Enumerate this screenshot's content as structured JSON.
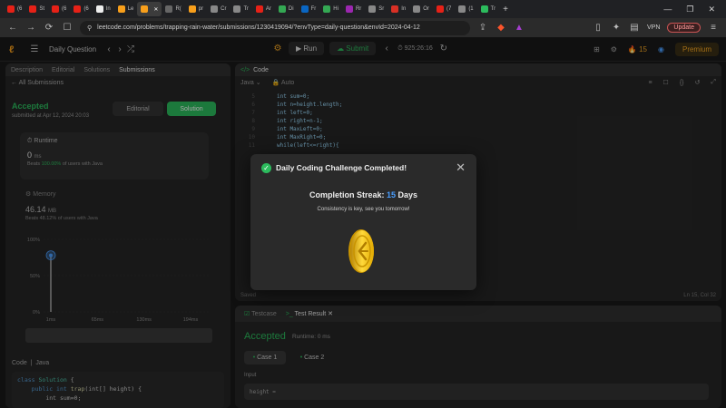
{
  "browser": {
    "tabs": [
      {
        "label": "(6",
        "color": "#e62117"
      },
      {
        "label": "St",
        "color": "#e62117"
      },
      {
        "label": "(6",
        "color": "#e62117"
      },
      {
        "label": "(6",
        "color": "#e62117"
      },
      {
        "label": "In",
        "color": "#eeeeee"
      },
      {
        "label": "Le",
        "color": "#f89f1b"
      },
      {
        "label": "",
        "color": "#f89f1b"
      },
      {
        "label": "R(",
        "color": "#666666"
      },
      {
        "label": "pr",
        "color": "#f89f1b"
      },
      {
        "label": "Cr",
        "color": "#888888"
      },
      {
        "label": "Tr",
        "color": "#888888"
      },
      {
        "label": "Ar",
        "color": "#e62117"
      },
      {
        "label": "Di",
        "color": "#34a853"
      },
      {
        "label": "Fr",
        "color": "#0a66c2"
      },
      {
        "label": "Hi",
        "color": "#34a853"
      },
      {
        "label": "Rr",
        "color": "#9c27b0"
      },
      {
        "label": "Sr",
        "color": "#888888"
      },
      {
        "label": "In",
        "color": "#d93025"
      },
      {
        "label": "Or",
        "color": "#888888"
      },
      {
        "label": "(7",
        "color": "#e62117"
      },
      {
        "label": "(1",
        "color": "#888888"
      },
      {
        "label": "Tr",
        "color": "#2cbb5d"
      }
    ],
    "url": "leetcode.com/problems/trapping-rain-water/submissions/1230419094/?envType=daily-question&envId=2024-04-12",
    "vpn": "VPN",
    "update": "Update"
  },
  "header": {
    "title": "Daily Question",
    "run": "Run",
    "submit": "Submit",
    "timer": "925:26:16",
    "streak": "15",
    "premium": "Premium"
  },
  "left": {
    "tabs": [
      "Description",
      "Editorial",
      "Solutions",
      "Submissions"
    ],
    "all_submissions": "All Submissions",
    "status": "Accepted",
    "submitted": "submitted at Apr 12, 2024 20:03",
    "editorial_btn": "Editorial",
    "solution_btn": "Solution",
    "runtime_label": "Runtime",
    "runtime_value": "0",
    "runtime_unit": "ms",
    "runtime_beats_prefix": "Beats",
    "runtime_beats_pct": "100.00%",
    "runtime_beats_suffix": "of users with Java",
    "memory_label": "Memory",
    "memory_value": "46.14",
    "memory_unit": "MB",
    "memory_beats": "Beats 48.12% of users with Java",
    "chart_y": [
      "100%",
      "50%",
      "0%"
    ],
    "chart_x": [
      "1ms",
      "65ms",
      "130ms",
      "194ms"
    ],
    "code_header": "Code",
    "code_lang": "Java",
    "code_line1_kw": "class",
    "code_line1_cls": "Solution",
    "code_line1_rest": " {",
    "code_line2_kw": "public int",
    "code_line2_fn": "trap",
    "code_line2_rest": "(int[] height) {",
    "code_line3": "int sum=0;"
  },
  "editor": {
    "tab": "Code",
    "lang": "Java",
    "auto": "Auto",
    "lines": [
      {
        "n": "5",
        "t": "int sum=0;"
      },
      {
        "n": "6",
        "t": "int n=height.length;"
      },
      {
        "n": "7",
        "t": "int left=0;"
      },
      {
        "n": "8",
        "t": "int right=n-1;"
      },
      {
        "n": "9",
        "t": "int MaxLeft=0;"
      },
      {
        "n": "10",
        "t": "int MaxRight=0;"
      },
      {
        "n": "11",
        "t": "while(left<=right){"
      }
    ],
    "saved": "Saved",
    "position": "Ln 15, Col 32"
  },
  "test": {
    "tab_testcase": "Testcase",
    "tab_result": "Test Result",
    "status": "Accepted",
    "runtime": "Runtime: 0 ms",
    "case1": "Case 1",
    "case2": "Case 2",
    "input_label": "Input",
    "input_value": "height ="
  },
  "modal": {
    "title": "Daily Coding Challenge Completed!",
    "streak_prefix": "Completion Streak:",
    "streak_num": "15",
    "streak_suffix": "Days",
    "subtitle": "Consistency is key, see you tomorrow!"
  },
  "chart_data": {
    "type": "scatter",
    "title": "",
    "xlabel": "",
    "ylabel": "",
    "x_ticks": [
      "1ms",
      "65ms",
      "130ms",
      "194ms"
    ],
    "y_ticks": [
      "100%",
      "50%",
      "0%"
    ],
    "series": [
      {
        "x": [
          1
        ],
        "y": [
          78
        ]
      }
    ]
  },
  "colors": {
    "accent_green": "#2cbb5d",
    "brand_orange": "#f89f1b",
    "streak_blue": "#4a9eff"
  }
}
